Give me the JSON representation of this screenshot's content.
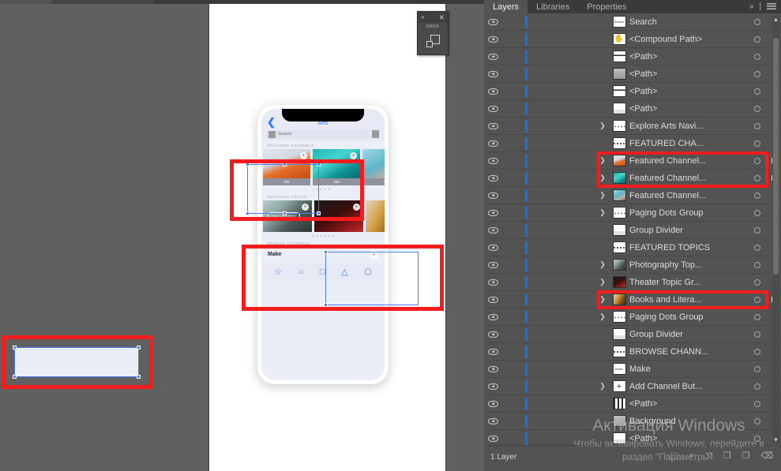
{
  "app": {
    "panel_tabs": [
      {
        "label": "Layers",
        "active": true
      },
      {
        "label": "Libraries",
        "active": false
      },
      {
        "label": "Properties",
        "active": false
      }
    ],
    "panel_tab_overflow": "»",
    "panel_tab_divider": "|",
    "panel_menu_icon": "hamburger-menu-icon"
  },
  "floating_panel": {
    "collapse_label": "»",
    "close_label": "✕",
    "tool_icon": "pathfinder-shapes-icon"
  },
  "phone": {
    "nav": {
      "back_icon": "chevron-left-icon",
      "title": "Arts"
    },
    "search": {
      "placeholder": "Search",
      "value": ""
    },
    "sections": {
      "featured_channels": "FEATURED CHANNELS",
      "featured_topics": "FEATURED TOPICS",
      "browse_channels": "BROWSE CHANNELS"
    },
    "featured_cards": [
      {
        "title": "Title",
        "art": "art-beach",
        "badge": "+"
      },
      {
        "title": "Title",
        "art": "art-surf",
        "badge": "+"
      },
      {
        "title": "Title",
        "art": "art-coast",
        "badge": "+"
      }
    ],
    "topic_cards": [
      {
        "pill": "PHOTOGRAPHY",
        "art": "art-camera",
        "badge": "+"
      },
      {
        "pill": "",
        "art": "art-theater",
        "badge": "+"
      },
      {
        "pill": "",
        "art": "art-books",
        "badge": "+"
      }
    ],
    "paging_dots_count": 4,
    "topic_dots_count": 6,
    "browse": {
      "name": "Make",
      "add_label": "+"
    },
    "tabbar": [
      {
        "icon": "star-icon",
        "glyph": "☆"
      },
      {
        "icon": "circle-icon",
        "glyph": "○"
      },
      {
        "icon": "square-icon",
        "glyph": "□"
      },
      {
        "icon": "triangle-icon",
        "glyph": "△"
      },
      {
        "icon": "hexagon-icon",
        "glyph": "⬡"
      }
    ]
  },
  "layers": {
    "rows": [
      {
        "name": "Search",
        "chevron": false,
        "selected": false,
        "thumb": "label",
        "thumb_text": "Search"
      },
      {
        "name": "<Compound Path>",
        "chevron": false,
        "selected": false,
        "thumb": "glyph",
        "thumb_text": "✋"
      },
      {
        "name": "<Path>",
        "chevron": false,
        "selected": false,
        "thumb": "lines"
      },
      {
        "name": "<Path>",
        "chevron": false,
        "selected": false,
        "thumb": "gray"
      },
      {
        "name": "<Path>",
        "chevron": false,
        "selected": false,
        "thumb": "lines"
      },
      {
        "name": "<Path>",
        "chevron": false,
        "selected": false,
        "thumb": "faint"
      },
      {
        "name": "Explore Arts Navi...",
        "chevron": true,
        "selected": false,
        "thumb": "dots"
      },
      {
        "name": "FEATURED CHA...",
        "chevron": false,
        "selected": false,
        "thumb": "dash"
      },
      {
        "name": "Featured Channel...",
        "chevron": true,
        "selected": true,
        "thumb": "art-beach"
      },
      {
        "name": "Featured Channel...",
        "chevron": true,
        "selected": true,
        "thumb": "art-surf"
      },
      {
        "name": "Featured Channel...",
        "chevron": true,
        "selected": false,
        "thumb": "art-coast"
      },
      {
        "name": "Paging Dots Group",
        "chevron": true,
        "selected": false,
        "thumb": "dots"
      },
      {
        "name": "Group Divider",
        "chevron": false,
        "selected": false,
        "thumb": "faint"
      },
      {
        "name": "FEATURED TOPICS",
        "chevron": false,
        "selected": false,
        "thumb": "dash"
      },
      {
        "name": "Photography Top...",
        "chevron": true,
        "selected": false,
        "thumb": "art-camera"
      },
      {
        "name": "Theater Topic Gr...",
        "chevron": true,
        "selected": false,
        "thumb": "art-theater"
      },
      {
        "name": "Books and Litera...",
        "chevron": true,
        "selected": true,
        "thumb": "art-books"
      },
      {
        "name": "Paging Dots Group",
        "chevron": true,
        "selected": false,
        "thumb": "dots"
      },
      {
        "name": "Group Divider",
        "chevron": false,
        "selected": false,
        "thumb": "faint"
      },
      {
        "name": "BROWSE CHANN...",
        "chevron": false,
        "selected": false,
        "thumb": "dash"
      },
      {
        "name": "Make",
        "chevron": false,
        "selected": false,
        "thumb": "label",
        "thumb_text": "Make"
      },
      {
        "name": "Add Channel But...",
        "chevron": true,
        "selected": false,
        "thumb": "plus"
      },
      {
        "name": "<Path>",
        "chevron": false,
        "selected": false,
        "thumb": "cols"
      },
      {
        "name": "Background",
        "chevron": false,
        "selected": false,
        "thumb": "gray"
      },
      {
        "name": "<Path>",
        "chevron": false,
        "selected": false,
        "thumb": "faint"
      }
    ],
    "footer_status": "1 Layer",
    "footer_icons": [
      {
        "name": "locate-object-icon",
        "glyph": "⬚"
      },
      {
        "name": "search-layer-icon",
        "glyph": "⌕"
      },
      {
        "name": "make-clipping-mask-icon",
        "glyph": "◱"
      },
      {
        "name": "new-sublayer-icon",
        "glyph": "❐"
      },
      {
        "name": "new-layer-icon",
        "glyph": "❐"
      },
      {
        "name": "delete-layer-icon",
        "glyph": "Ὕ1"
      }
    ]
  },
  "watermark": {
    "line1": "Активация Windows",
    "line2": "Чтобы активировать Windows, перейдите в раздел \"Параметры\"."
  },
  "colors": {
    "annotation_red": "#f41c1c",
    "selection_blue": "#4a7cf0",
    "layer_blue": "#1473e6",
    "ios_blue": "#2f7bf6",
    "panel_bg": "#535353"
  }
}
